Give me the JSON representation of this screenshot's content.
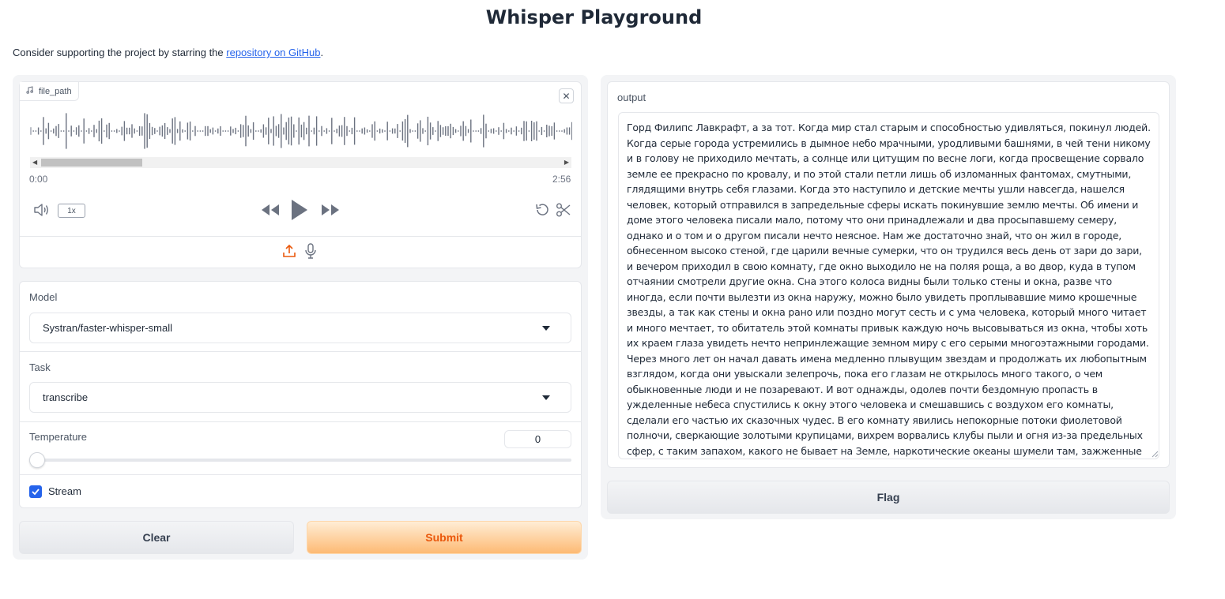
{
  "header": {
    "title": "Whisper Playground",
    "intro_prefix": "Consider supporting the project by starring the ",
    "intro_link": "repository on GitHub",
    "intro_suffix": "."
  },
  "audio": {
    "label": "file_path",
    "time_start": "0:00",
    "time_end": "2:56",
    "playback_rate": "1x",
    "scroll_position": 0.15
  },
  "model": {
    "label": "Model",
    "value": "Systran/faster-whisper-small"
  },
  "task": {
    "label": "Task",
    "value": "transcribe"
  },
  "temperature": {
    "label": "Temperature",
    "value": "0",
    "slider_fraction": 0
  },
  "stream": {
    "label": "Stream",
    "checked": true
  },
  "actions": {
    "clear_label": "Clear",
    "submit_label": "Submit",
    "flag_label": "Flag"
  },
  "output": {
    "label": "output",
    "text": " Горд Филипс Лавкрафт, а за тот. Когда мир стал старым и способностью удивляться, покинул людей. Когда серые города устремились в дымное небо мрачными, уродливыми башнями, в чей тени никому и в голову не приходило мечтать, а солнце или цитущим по весне логи, когда просвещение сорвало земле ее прекрасно по кровалу, и по этой стали петли лишь об изломанных фантомах, смутными, глядящими внутрь себя глазами. Когда это наступило и детские мечты ушли навсегда, нашелся человек, который отправился в запредельные сферы искать покинувшие землю мечты. Об имени и доме этого человека писали мало, потому что они принадлежали и два просыпавшему семеру, однако и о том и о другом писали нечто неясное. Нам же достаточно знай, что он жил в городе, обнесенном высоко стеной, где царили вечные сумерки, что он трудился весь день от зари до зари, и вечером приходил в свою комнату, где окно выходило не на поляя роща, а во двор, куда в тупом отчаянии смотрели другие окна. Сна этого колоса видны были только стены и окна, разве что иногда, если почти вылезти из окна наружу, можно было увидеть проплывавшие мимо крошечные звезды, а так как стены и окна рано или поздно могут сесть и с ума человека, который много читает и много мечтает, то обитатель этой комнаты привык каждую ночь высовываться из окна, чтобы хоть их краем глаза увидеть нечто непринлежащие земном миру с его серыми многоэтажными городами. Через много лет он начал давать имена медленно плывущим звездам и продолжать их любопытным взглядом, когда они увыскали зелепрочь, пока его глазам не открылось много такого, о чем обыкновенные люди и не позаревают. И вот однажды, одолев почти бездомную пропасть в ужделенные небеса спустились к окну этого человека и смешавшись с воздухом его комнаты, сделали его частью их сказочных чудес. В его комнату явились непокорные потоки фиолетовой полночи, сверкающие золотыми крупицами, вихрем ворвались клубы пыли и огня из-за предельных сфер, с таким запахом, какого не бывает на Земле, наркотические океаны шумели там, зажженные солнцами, о которых люди не имеют немалейшего понятия и в их немыслимых глубинах плавали невиданные дельфины и морские"
  },
  "colors": {
    "accent_orange": "#ea580c",
    "checkbox_blue": "#2563eb",
    "link_blue": "#2563eb"
  },
  "icons": {
    "file": "music-note-icon",
    "close": "close-icon",
    "volume": "volume-icon",
    "rewind": "rewind-icon",
    "play": "play-icon",
    "forward": "fast-forward-icon",
    "undo": "undo-icon",
    "trim": "scissors-icon",
    "upload": "upload-icon",
    "mic": "microphone-icon"
  }
}
